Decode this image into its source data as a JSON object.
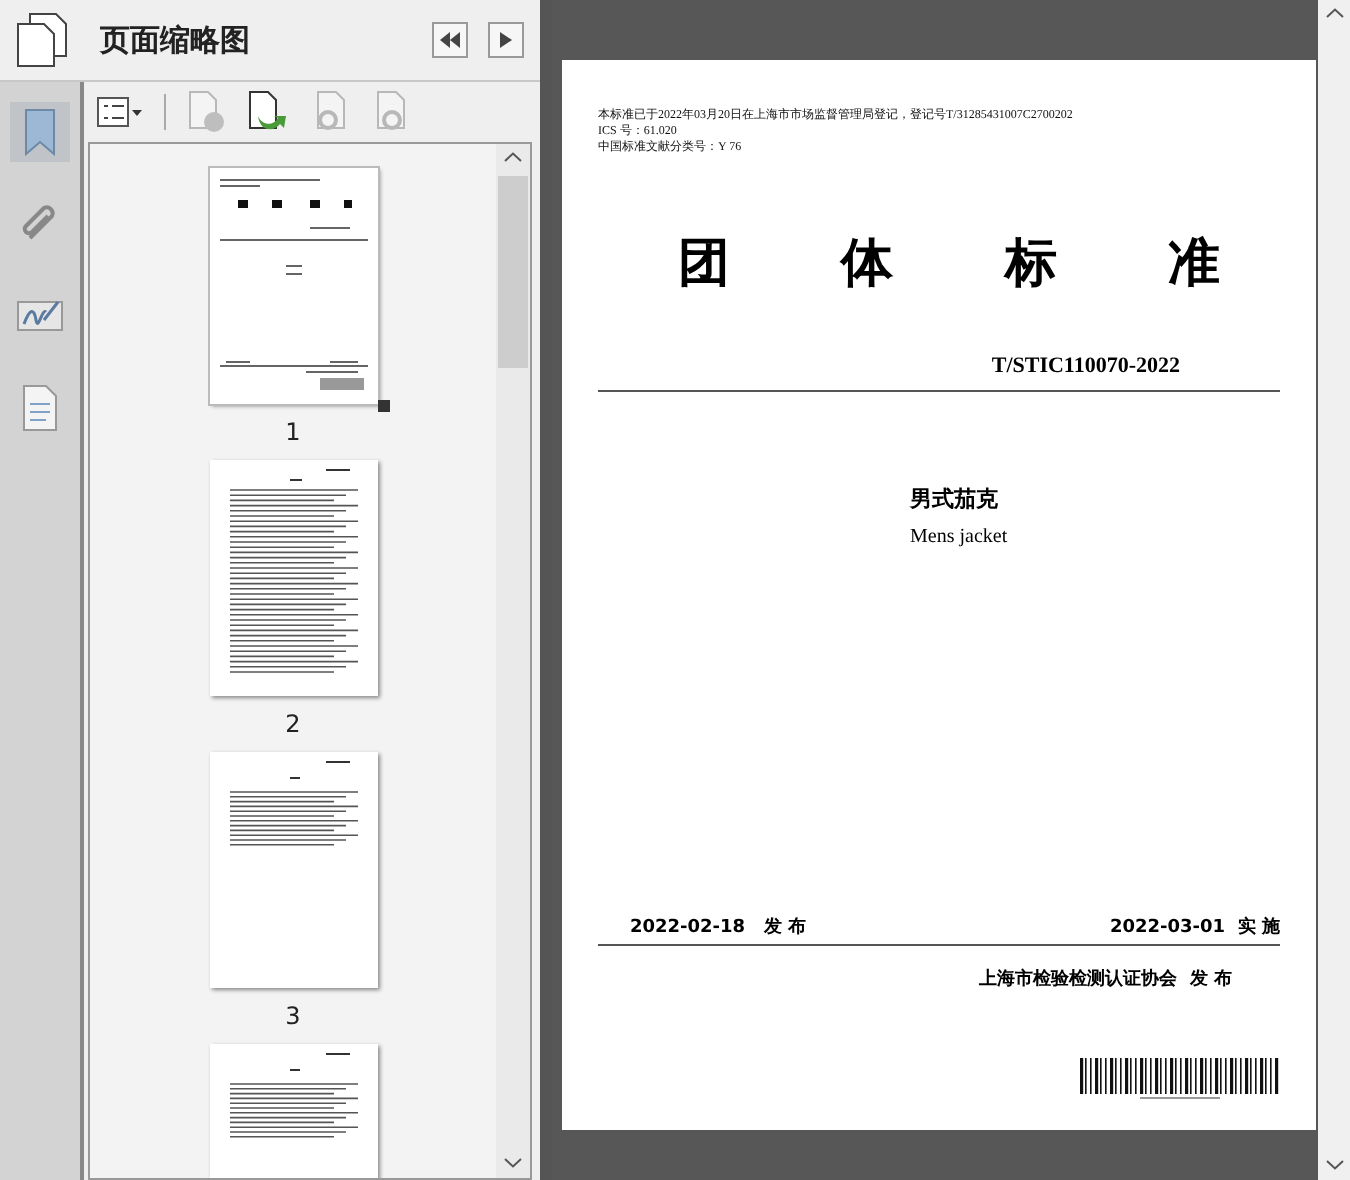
{
  "panel": {
    "title": "页面缩略图"
  },
  "rail": [
    {
      "kind": "bookmark",
      "selected": true
    },
    {
      "kind": "attachment",
      "selected": false
    },
    {
      "kind": "signature",
      "selected": false
    },
    {
      "kind": "layers",
      "selected": false
    }
  ],
  "toolbar": [
    {
      "kind": "options",
      "disabled": false
    },
    {
      "kind": "delete",
      "disabled": true
    },
    {
      "kind": "insert",
      "disabled": false
    },
    {
      "kind": "undo",
      "disabled": true
    },
    {
      "kind": "redo",
      "disabled": true
    }
  ],
  "thumbnails": [
    {
      "kind": "cover",
      "label": "1",
      "selected": true
    },
    {
      "kind": "contents",
      "label": "2",
      "selected": false
    },
    {
      "kind": "text",
      "label": "3",
      "selected": false
    },
    {
      "kind": "text",
      "selected": false
    }
  ],
  "page": {
    "notes": [
      "本标准已于2022年03月20日在上海市市场监督管理局登记，登记号T/31285431007C2700202",
      "ICS 号：61.020",
      "中国标准文献分类号：Y 76"
    ],
    "title_chars": [
      "团",
      "体",
      "标",
      "准"
    ],
    "code": "T/STIC110070-2022",
    "name_zh": "男式茄克",
    "name_en": "Mens jacket",
    "issued": {
      "date": "2022-02-18",
      "word": "发 布"
    },
    "effective": {
      "date": "2022-03-01",
      "word": "实 施"
    },
    "publisher": {
      "name": "上海市检验检测认证协会",
      "word": "发 布"
    }
  }
}
